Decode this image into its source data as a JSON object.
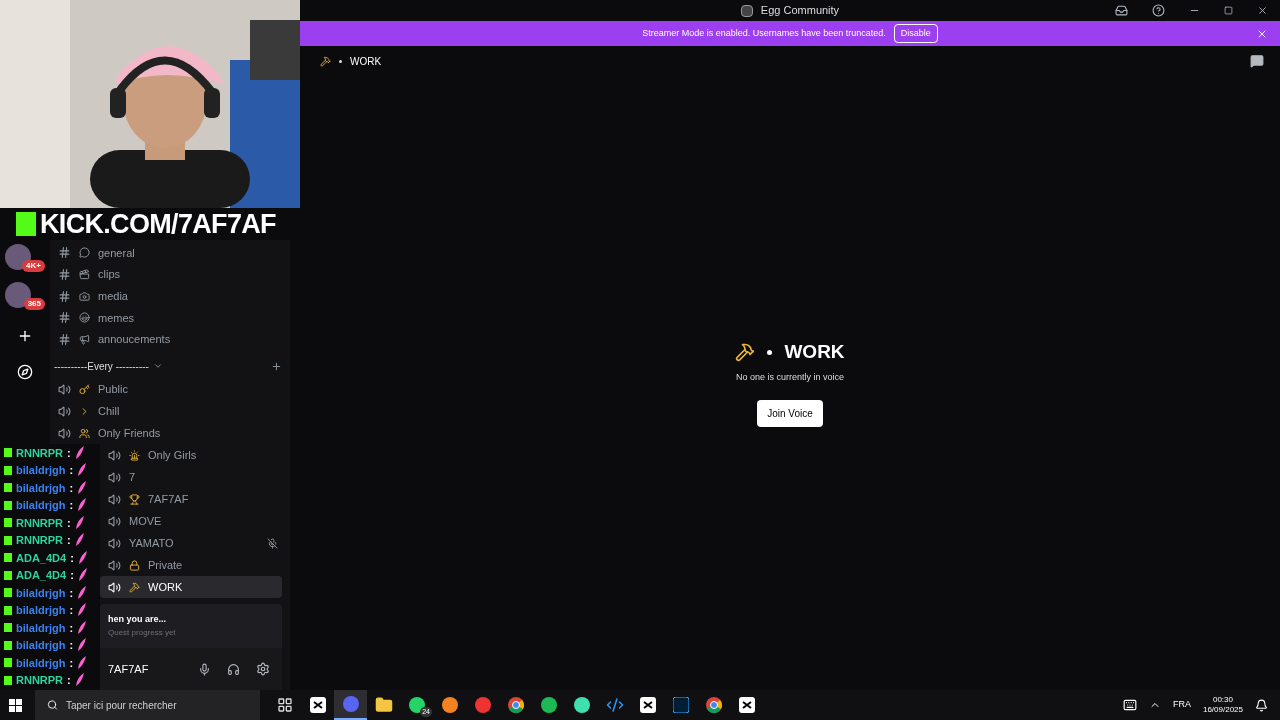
{
  "window": {
    "title": "Egg Community"
  },
  "banner": {
    "text": "Streamer Mode is enabled. Usernames have been truncated.",
    "button": "Disable"
  },
  "stream_overlay": {
    "kind": "picture",
    "url_text": "KICK.COM/7AF7AF"
  },
  "server_badges": [
    "4K+",
    "365"
  ],
  "text_channels": [
    {
      "name": "general",
      "selected": false
    },
    {
      "name": "clips",
      "selected": false
    },
    {
      "name": "media",
      "selected": false
    },
    {
      "name": "memes",
      "selected": false
    },
    {
      "name": "annoucements",
      "selected": false
    }
  ],
  "category": {
    "name": "----------Every ----------"
  },
  "voice_channels": [
    {
      "name": "Public",
      "selected": false,
      "muted": false
    },
    {
      "name": "Chill",
      "selected": false,
      "muted": false
    },
    {
      "name": "Only Friends",
      "selected": false,
      "muted": false
    },
    {
      "name": "Only Girls",
      "selected": false,
      "muted": false
    },
    {
      "name": "7",
      "selected": false,
      "muted": false
    },
    {
      "name": "7AF7AF",
      "selected": false,
      "muted": false
    },
    {
      "name": "MOVE",
      "selected": false,
      "muted": false
    },
    {
      "name": "YAMATO",
      "selected": false,
      "muted": true
    },
    {
      "name": "Private",
      "selected": false,
      "muted": false
    },
    {
      "name": "WORK",
      "selected": true,
      "muted": false
    }
  ],
  "chat": [
    {
      "user": "RNNRPR",
      "text": ":",
      "color": "#2fd39b"
    },
    {
      "user": "bilaldrjgh",
      "text": ":",
      "color": "#3b82f0"
    },
    {
      "user": "bilaldrjgh",
      "text": ":",
      "color": "#3b82f0"
    },
    {
      "user": "bilaldrjgh",
      "text": ":",
      "color": "#3b82f0"
    },
    {
      "user": "RNNRPR",
      "text": ":",
      "color": "#2fd39b"
    },
    {
      "user": "RNNRPR",
      "text": ":",
      "color": "#2fd39b"
    },
    {
      "user": "ADA_4D4",
      "text": ":",
      "color": "#2fd39b"
    },
    {
      "user": "ADA_4D4",
      "text": ":",
      "color": "#2fd39b"
    },
    {
      "user": "bilaldrjgh",
      "text": ":",
      "color": "#3b82f0"
    },
    {
      "user": "bilaldrjgh",
      "text": ":",
      "color": "#3b82f0"
    },
    {
      "user": "bilaldrjgh",
      "text": ":",
      "color": "#3b82f0"
    },
    {
      "user": "bilaldrjgh",
      "text": ":",
      "color": "#3b82f0"
    },
    {
      "user": "bilaldrjgh",
      "text": ":",
      "color": "#3b82f0"
    },
    {
      "user": "RNNRPR",
      "text": ":",
      "color": "#2fd39b"
    }
  ],
  "quest": {
    "title": "hen you are...",
    "subtitle": "Quest progress yet"
  },
  "user": {
    "name": "7AF7AF"
  },
  "channel_header": {
    "name": "WORK"
  },
  "voice_stage": {
    "name": "WORK",
    "status": "No one is currently in voice",
    "button": "Join Voice"
  },
  "taskbar": {
    "search_placeholder": "Taper ici pour rechercher",
    "apps": [
      {
        "kind": "taskview",
        "selected": false
      },
      {
        "kind": "capcut",
        "selected": false
      },
      {
        "kind": "discord",
        "selected": true
      },
      {
        "kind": "folder",
        "selected": false
      },
      {
        "kind": "whatsapp",
        "selected": false,
        "badge": "24"
      },
      {
        "kind": "orange",
        "selected": false
      },
      {
        "kind": "record",
        "selected": false
      },
      {
        "kind": "chrome",
        "selected": false
      },
      {
        "kind": "spotify",
        "selected": false
      },
      {
        "kind": "teal",
        "selected": false
      },
      {
        "kind": "vscode",
        "selected": false
      },
      {
        "kind": "capcut",
        "selected": false
      },
      {
        "kind": "photoshop",
        "selected": false
      },
      {
        "kind": "chrome",
        "selected": false
      },
      {
        "kind": "capcut",
        "selected": false
      }
    ],
    "language": "FRA",
    "time": "00:30",
    "date": "16/09/2025"
  }
}
